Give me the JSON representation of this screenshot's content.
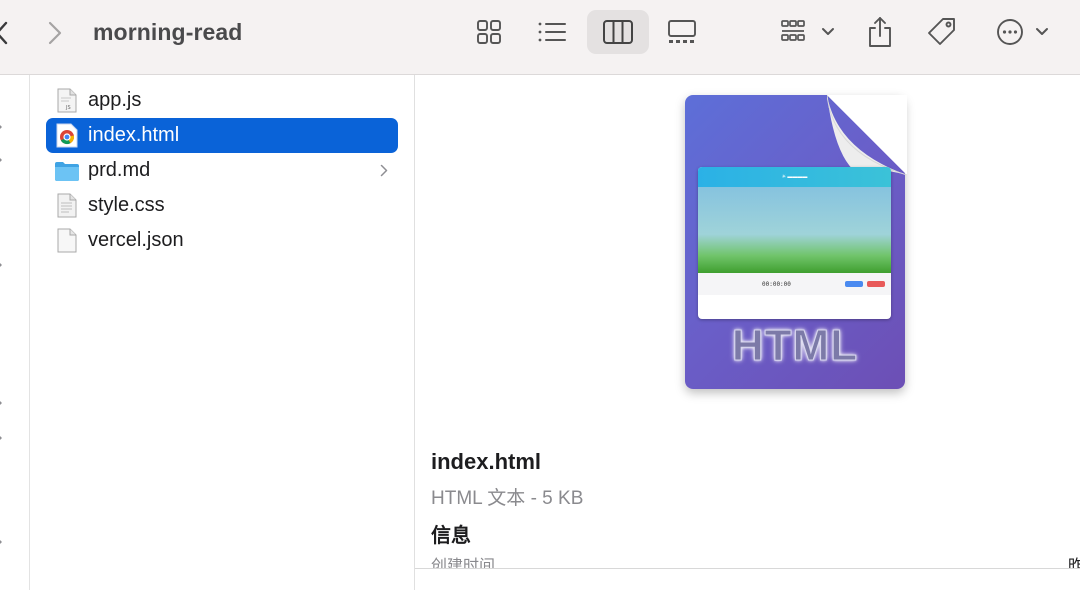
{
  "toolbar": {
    "title": "morning-read",
    "buttons": [
      {
        "name": "back",
        "icon": "chevron-left-icon"
      },
      {
        "name": "forward",
        "icon": "chevron-right-icon"
      },
      {
        "name": "view-icons",
        "icon": "grid-icon"
      },
      {
        "name": "view-list",
        "icon": "list-icon"
      },
      {
        "name": "view-columns",
        "icon": "columns-icon",
        "active": true
      },
      {
        "name": "view-gallery",
        "icon": "gallery-icon"
      },
      {
        "name": "group",
        "icon": "group-icon"
      },
      {
        "name": "share",
        "icon": "share-icon"
      },
      {
        "name": "tags",
        "icon": "tag-icon"
      },
      {
        "name": "more",
        "icon": "ellipsis-circle-icon"
      }
    ]
  },
  "files": [
    {
      "name": "app.js",
      "icon": "js-file-icon",
      "selected": false,
      "folder": false
    },
    {
      "name": "index.html",
      "icon": "chrome-html-icon",
      "selected": true,
      "folder": false
    },
    {
      "name": "prd.md",
      "icon": "folder-icon",
      "selected": false,
      "folder": true
    },
    {
      "name": "style.css",
      "icon": "css-file-icon",
      "selected": false,
      "folder": false
    },
    {
      "name": "vercel.json",
      "icon": "blank-file-icon",
      "selected": false,
      "folder": false
    }
  ],
  "preview": {
    "thumbnail_label": "HTML",
    "thumbnail_time": "00:00:00",
    "filename": "index.html",
    "kind": "HTML 文本 - 5 KB",
    "info_heading": "信息",
    "created_label": "创建时间",
    "cut_text": "昨"
  },
  "colors": {
    "selection": "#0a63d8",
    "toolbar_bg": "#f5f2f2",
    "doc_gradient_start": "#5d6fd8",
    "doc_gradient_end": "#6c4fb5",
    "folder": "#5ab7ee"
  }
}
